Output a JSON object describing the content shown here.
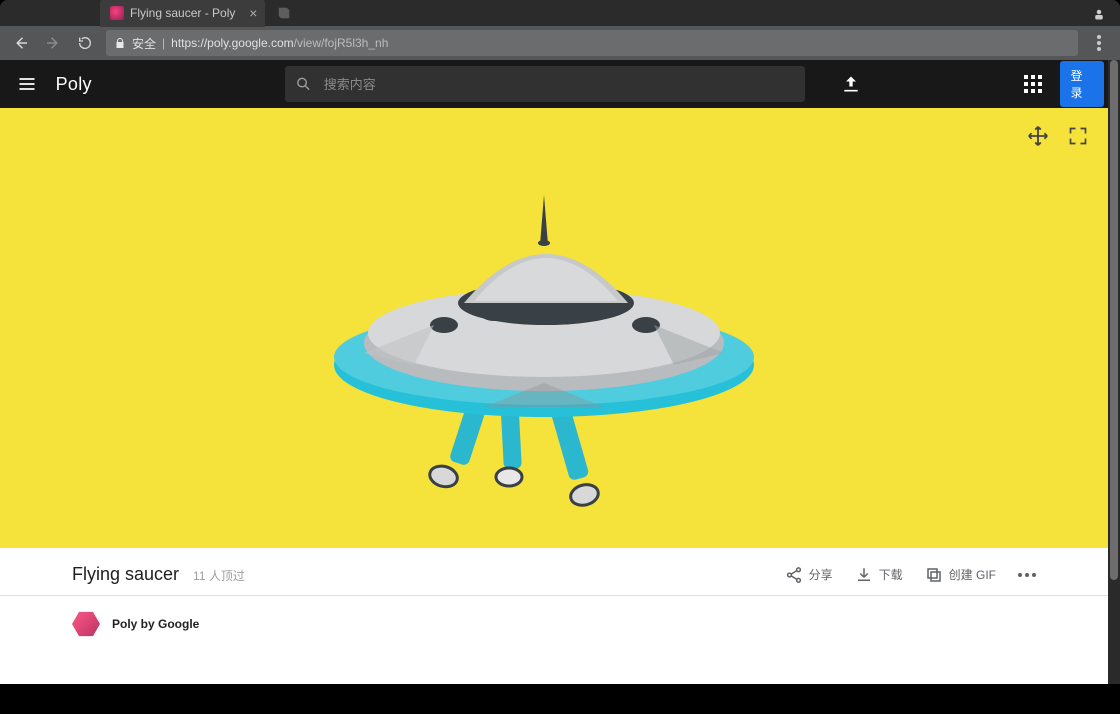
{
  "browser": {
    "tab_title": "Flying saucer - Poly",
    "address_secure_label": "安全",
    "url_host": "https://poly.google.com",
    "url_path": "/view/fojR5l3h_nh"
  },
  "header": {
    "logo": "Poly",
    "search_placeholder": "搜索内容",
    "login_label": "登录"
  },
  "asset": {
    "title": "Flying saucer",
    "likes_text": "11 人顶过",
    "author": "Poly by Google"
  },
  "actions": {
    "share": "分享",
    "download": "下载",
    "create_gif": "创建 GIF"
  },
  "viewer": {
    "bg_color": "#f5e23a"
  }
}
